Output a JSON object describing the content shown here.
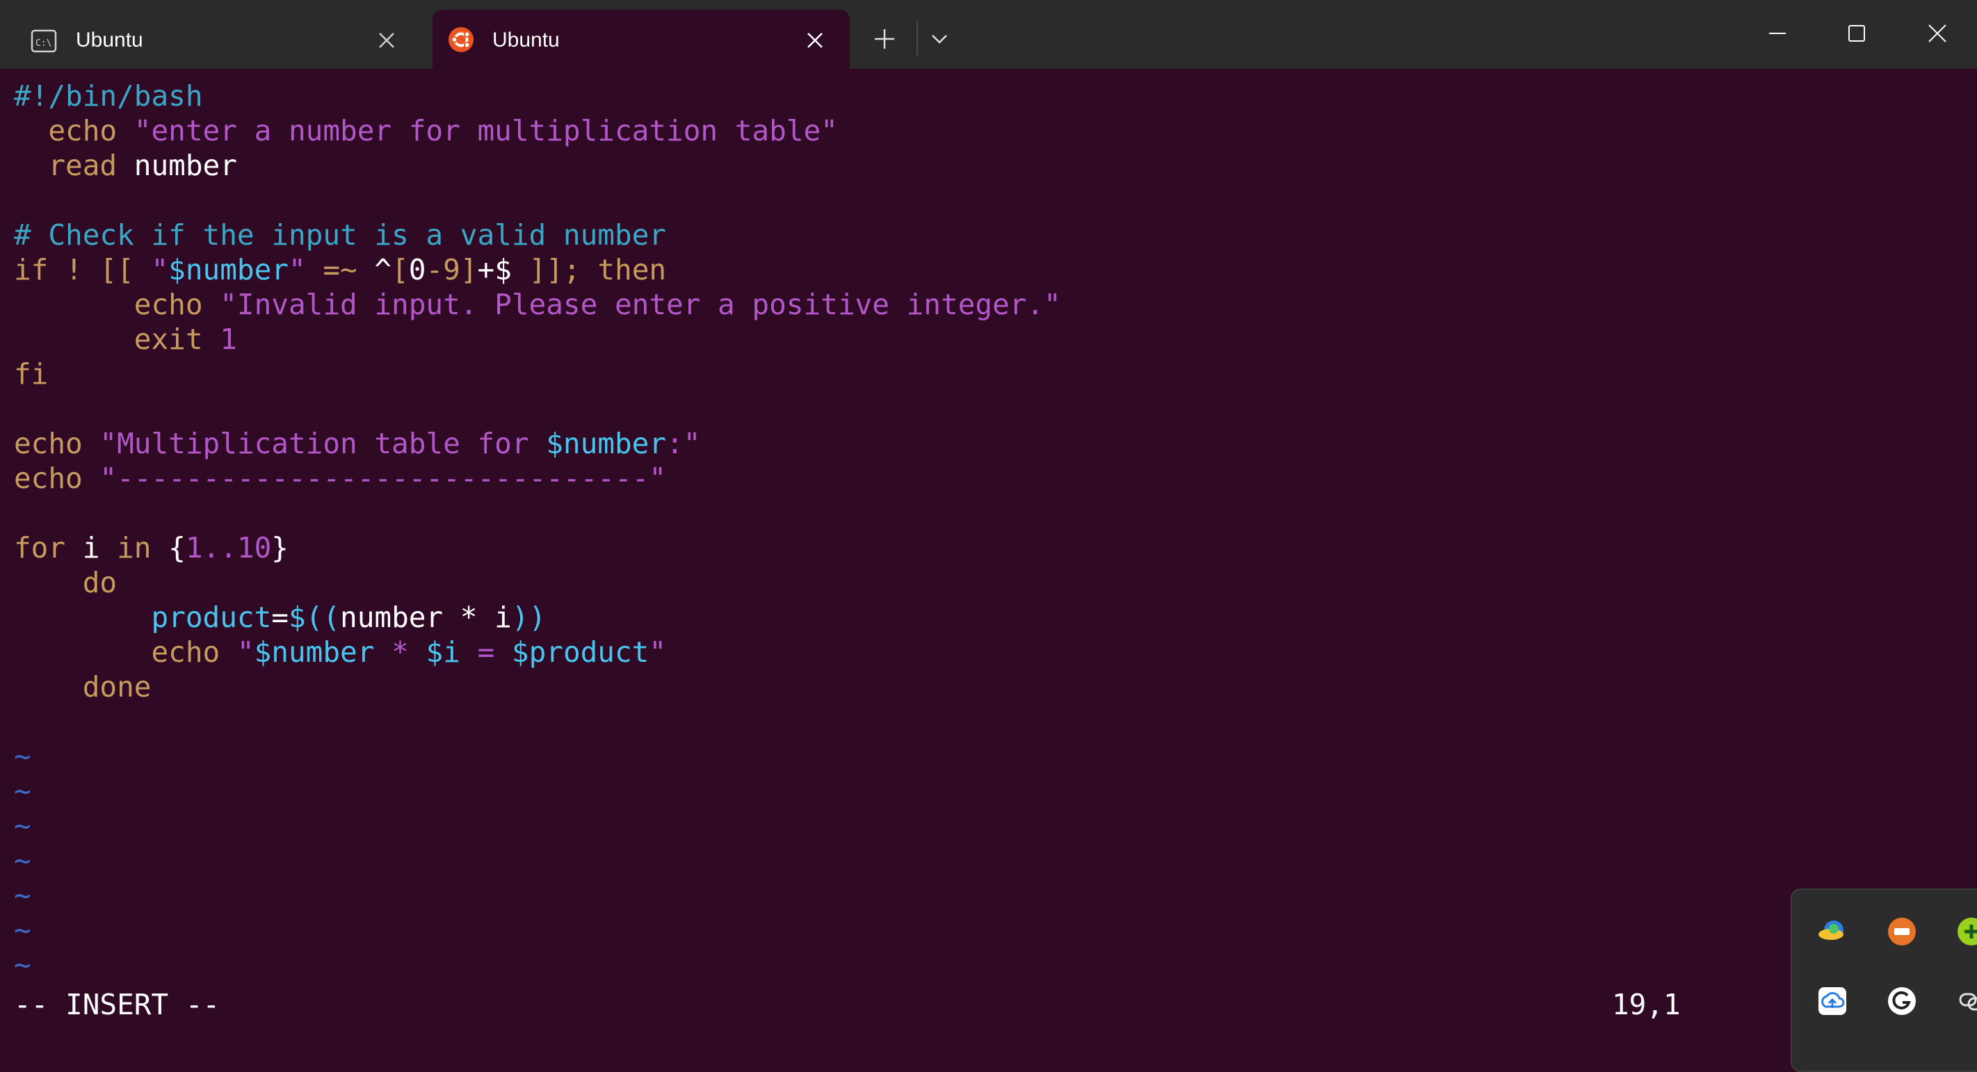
{
  "tabs": [
    {
      "title": "Ubuntu",
      "icon": "console-icon",
      "active": false
    },
    {
      "title": "Ubuntu",
      "icon": "ubuntu-logo-icon",
      "active": true
    }
  ],
  "editor": {
    "lines": {
      "l1": "#!/bin/bash",
      "l2a": "  echo ",
      "l2b": "\"enter a number for multiplication table\"",
      "l3a": "  read ",
      "l3b": "number",
      "l5": "# Check if the input is a valid number",
      "l6a": "if ! [[ ",
      "l6b": "\"",
      "l6c": "$number",
      "l6d": "\"",
      "l6e": " =~ ",
      "l6f": "^",
      "l6g": "[",
      "l6h": "0",
      "l6i": "-9]",
      "l6j": "+$",
      "l6k": " ]]; then",
      "l7a": "       echo ",
      "l7b": "\"Invalid input. Please enter a positive integer.\"",
      "l8a": "       exit ",
      "l8b": "1",
      "l9": "fi",
      "l11a": "echo ",
      "l11b": "\"Multiplication table for ",
      "l11c": "$number",
      "l11d": ":\"",
      "l12a": "echo ",
      "l12b": "\"-------------------------------\"",
      "l14a": "for ",
      "l14b": "i",
      "l14c": " in ",
      "l14d": "{",
      "l14e": "1..10",
      "l14f": "}",
      "l15": "    do",
      "l16a": "        product",
      "l16b": "=",
      "l16c": "$((",
      "l16d": "number * i",
      "l16e": "))",
      "l17a": "        echo ",
      "l17b": "\"",
      "l17c": "$number",
      "l17d": " * ",
      "l17e": "$i",
      "l17f": " = ",
      "l17g": "$product",
      "l17h": "\"",
      "l18": "    done"
    },
    "tilde": "~",
    "mode": "-- INSERT --",
    "position": "19,1"
  },
  "colors": {
    "background": "#300a24",
    "keyword": "#c79a5e",
    "string": "#b257c8",
    "variable": "#49c4ef",
    "comment": "#3aa7c6",
    "tilde": "#3d6ec6"
  },
  "tray_icons": [
    "globe-app-icon",
    "orange-app-icon",
    "green-plus-icon",
    "cloud-upload-icon",
    "grammarly-icon",
    "link-app-icon"
  ]
}
